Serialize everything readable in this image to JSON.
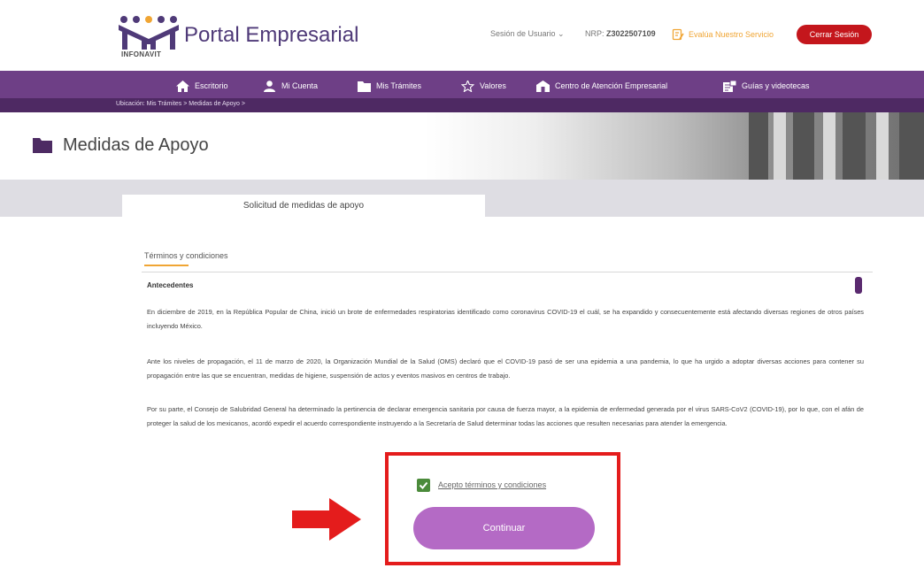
{
  "header": {
    "logo_text": "INFONAVIT",
    "portal_title": "Portal Empresarial",
    "session_menu": "Sesión de Usuario ⌄",
    "nrp_label": "NRP:",
    "nrp_value": "Z3022507109",
    "evaluate_link": "Evalúa Nuestro Servicio",
    "logout_button": "Cerrar Sesión",
    "colors": {
      "brand": "#4f3a78",
      "logout": "#c4161c",
      "evaluate": "#f0a534"
    }
  },
  "nav": {
    "color": "#6e3f86",
    "items": [
      {
        "label": "Escritorio",
        "icon": "home-icon"
      },
      {
        "label": "Mi Cuenta",
        "icon": "user-icon"
      },
      {
        "label": "Mis Trámites",
        "icon": "folder-icon"
      },
      {
        "label": "Valores",
        "icon": "star-icon"
      },
      {
        "label": "Centro de Atención Empresarial",
        "icon": "building-icon"
      },
      {
        "label": "Guías y videotecas",
        "icon": "video-guide-icon"
      }
    ],
    "breadcrumb": "Ubicación: Mis Trámites > Medidas de Apoyo >"
  },
  "page": {
    "title": "Medidas de Apoyo",
    "title_icon": "folder-icon",
    "tab_label": "Solicitud de medidas de apoyo"
  },
  "content": {
    "section_label": "Términos y condiciones",
    "subheading": "Antecedentes",
    "paragraphs": [
      "En diciembre de 2019, en la República Popular de China, inició un brote de enfermedades respiratorias identificado como coronavirus COVID-19 el cuál, se ha expandido y consecuentemente está afectando diversas regiones de otros países incluyendo México.",
      "Ante los niveles de propagación, el 11 de marzo de 2020, la Organización Mundial de la Salud (OMS) declaró que el COVID-19 pasó de ser una epidemia a una pandemia, lo que ha urgido a adoptar diversas acciones para contener su propagación entre las que se encuentran, medidas de higiene, suspensión de actos y eventos masivos en centros de trabajo.",
      "Por su parte, el Consejo de Salubridad General ha determinado la pertinencia de declarar emergencia sanitaria por causa de fuerza mayor, a la epidemia de enfermedad generada por el virus SARS-CoV2 (COVID-19), por lo que, con el afán de proteger la salud de los mexicanos, acordó expedir el acuerdo correspondiente instruyendo a la Secretaría de Salud determinar todas las acciones que resulten necesarias para atender la emergencia."
    ]
  },
  "actions": {
    "accept_checked": true,
    "accept_label": "Acepto términos y condiciones",
    "continue_button": "Continuar",
    "colors": {
      "checkbox": "#4b8b3b",
      "continue": "#b46ac5",
      "highlight": "#e41c1c"
    }
  }
}
